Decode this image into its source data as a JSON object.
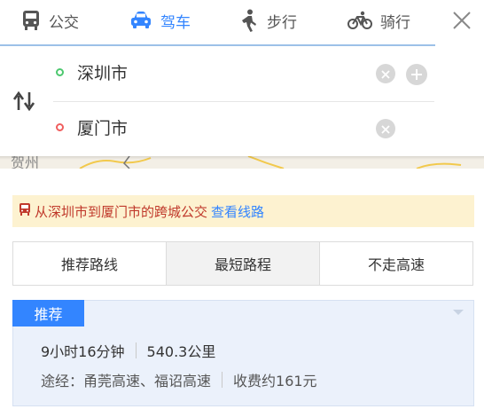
{
  "modes": [
    {
      "label": "公交",
      "icon": "bus-icon",
      "active": false
    },
    {
      "label": "驾车",
      "icon": "car-icon",
      "active": true
    },
    {
      "label": "步行",
      "icon": "walk-icon",
      "active": false
    },
    {
      "label": "骑行",
      "icon": "bike-icon",
      "active": false
    }
  ],
  "route": {
    "start": "深圳市",
    "end": "厦门市"
  },
  "map": {
    "label": "贺州"
  },
  "notice": {
    "text": "从深圳市到厦门市的跨城公交",
    "link": "查看线路"
  },
  "strategies": [
    "推荐路线",
    "最短路程",
    "不走高速"
  ],
  "card": {
    "badge": "推荐",
    "duration": "9小时16分钟",
    "distance": "540.3公里",
    "via": "途经：甬莞高速、福诏高速",
    "toll": "收费约161元"
  },
  "colors": {
    "accent": "#3385ff",
    "notice_bg": "#fdf2d0",
    "notice_text": "#c0392b",
    "start_dot": "#4dc86f",
    "end_dot": "#f05e5e"
  }
}
